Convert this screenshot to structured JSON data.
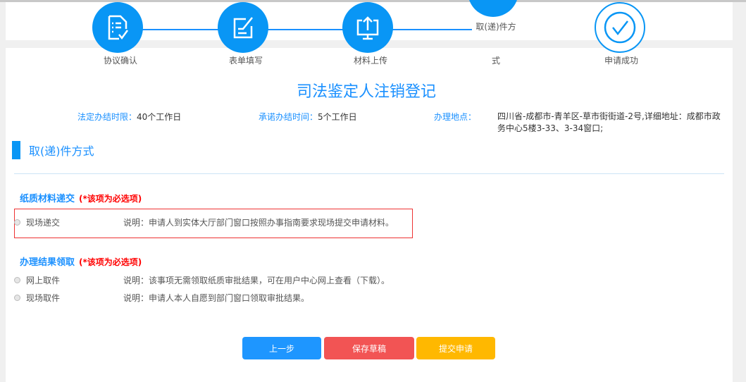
{
  "steps": [
    {
      "label": "协议确认",
      "icon": "document-check-icon"
    },
    {
      "label": "表单填写",
      "icon": "form-edit-icon"
    },
    {
      "label": "材料上传",
      "icon": "upload-monitor-icon"
    },
    {
      "label_line1": "取(递)件方",
      "label_line2": "式",
      "icon": "delivery-icon"
    },
    {
      "label": "申请成功",
      "icon": "check-circle-icon"
    }
  ],
  "title": "司法鉴定人注销登记",
  "info": {
    "legal_label": "法定办结时限：",
    "legal_value": "40个工作日",
    "promise_label": "承诺办结时间：",
    "promise_value": "5个工作日",
    "place_label": "办理地点：",
    "place_value": "四川省-成都市-青羊区-草市街街道-2号,详细地址：成都市政务中心5楼3-33、3-34窗口;"
  },
  "section_title": "取(递)件方式",
  "groups": [
    {
      "title": "纸质材料递交",
      "required": "(*该项为必选项)",
      "options": [
        {
          "name": "现场递交",
          "desc": "说明：申请人到实体大厅部门窗口按照办事指南要求现场提交申请材料。"
        }
      ]
    },
    {
      "title": "办理结果领取",
      "required": "(*该项为必选项)",
      "options": [
        {
          "name": "网上取件",
          "desc": "说明：该事项无需领取纸质审批结果，可在用户中心网上查看（下载）。"
        },
        {
          "name": "现场取件",
          "desc": "说明：申请人本人自愿到部门窗口领取审批结果。"
        }
      ]
    }
  ],
  "buttons": {
    "prev": "上一步",
    "save": "保存草稿",
    "submit": "提交申请"
  },
  "colors": {
    "primary": "#0996f5",
    "danger": "#f25454",
    "warning": "#ffb800"
  }
}
